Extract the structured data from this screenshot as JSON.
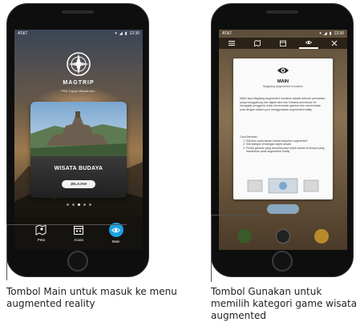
{
  "phone_left": {
    "status": {
      "carrier": "AT&T",
      "time": "12:30"
    },
    "brand": "MAGTRIP",
    "tagline": "PSK Tujuan Wisata Ind..",
    "card": {
      "title": "WISATA BUDAYA",
      "button": "JELAJAH"
    },
    "pagination": {
      "count": 5,
      "active_index": 2
    },
    "tabs": [
      {
        "label": "Peta",
        "icon": "map-icon"
      },
      {
        "label": "Acara",
        "icon": "calendar-icon"
      },
      {
        "label": "Main",
        "icon": "ar-eye-icon",
        "highlighted": true
      }
    ]
  },
  "phone_right": {
    "status": {
      "carrier": "AT&T",
      "time": "12:30"
    },
    "toolbar_icons": [
      "menu-icon",
      "map-icon",
      "calendar-icon",
      "ar-eye-icon",
      "close-icon"
    ],
    "dialog": {
      "title": "MAIN",
      "subtitle": "Magtrang Augmented Inovation",
      "body": "MAIN atau Magtang Augmented Inovation adalah sebuah permainan yang menggabung kan digital dan real. Dimana permainan ini mengajak pengguna untuk menemukan gambar dan menemukan pola dengan sistem joon menggunakan augmented reality.",
      "howto_title": "Cara Bermain:",
      "steps": [
        "Klik ikon pada kanan bawah tampilan augmented",
        "Klik kategori tentangan objek wisata",
        "Pindai gambar yang tersedia pada objek wisata di tempat yang disediakan pada augmented reality"
      ]
    }
  },
  "captions": {
    "left": "Tombol Main untuk masuk ke menu augmented reality",
    "right": "Tombol Gunakan untuk memilih kategori game wisata augmented"
  },
  "colors": {
    "accent": "#1ba1e2",
    "phone_body": "#0e0e0e"
  }
}
